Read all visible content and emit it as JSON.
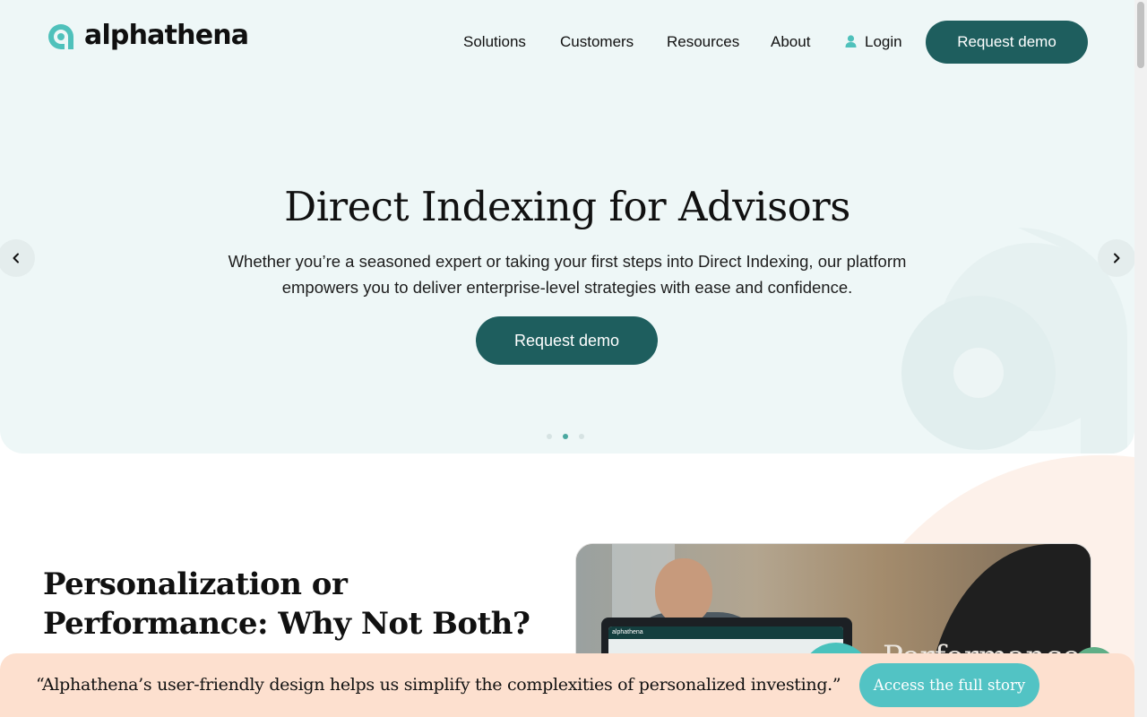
{
  "brand": {
    "name": "alphathena",
    "logo_icon": "alphathena-a-mark-icon",
    "primary_color": "#1e5e5e",
    "accent_color": "#52c3c4",
    "hero_bg": "#eef7f7",
    "banner_bg": "#fde0cf"
  },
  "nav": {
    "items": [
      "Solutions",
      "Customers",
      "Resources",
      "About"
    ],
    "login_label": "Login",
    "login_icon": "user-icon",
    "cta_label": "Request demo"
  },
  "hero": {
    "title": "Direct Indexing for Advisors",
    "subtitle": "Whether you’re a seasoned expert or taking your first steps into Direct Indexing, our platform empowers you to deliver enterprise-level strategies with ease and confidence.",
    "cta_label": "Request demo",
    "prev_icon": "chevron-left-icon",
    "next_icon": "chevron-right-icon",
    "slide_count": 3,
    "active_slide": 2
  },
  "section": {
    "title": "Personalization or Performance: Why Not Both?",
    "media_overlay_text": "Performance",
    "media_screen_logo": "alphathena"
  },
  "banner": {
    "quote": "“Alphathena’s user-friendly design helps us simplify the complexities of personalized investing.”",
    "cta_label": "Access the full story"
  },
  "chat_icon": "chat-bubble-icon"
}
